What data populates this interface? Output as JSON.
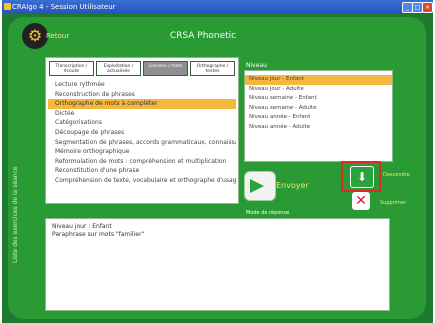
{
  "window": {
    "title": "CRAlgo 4 - Session Utilisateur",
    "buttons": {
      "minimize": "_",
      "maximize": "□",
      "close": "×"
    }
  },
  "header": {
    "title": "CRSA Phonetic",
    "home_label": "Retour"
  },
  "left_strip_label": "Liste des exercices de la séance",
  "tabs": [
    {
      "label": "Transcription / écoute",
      "active": false
    },
    {
      "label": "Exploitation / actualisée",
      "active": false
    },
    {
      "label": "Liaisons / mots",
      "active": true
    },
    {
      "label": "Orthographe / textes",
      "active": false
    }
  ],
  "exercises": [
    {
      "label": "Lecture rythmée",
      "selected": false
    },
    {
      "label": "Reconstruction de phrases",
      "selected": false
    },
    {
      "label": "Orthographe de mots à compléter",
      "selected": true
    },
    {
      "label": "Dictée",
      "selected": false
    },
    {
      "label": "Catégorisations",
      "selected": false
    },
    {
      "label": "Découpage de phrases",
      "selected": false
    },
    {
      "label": "Segmentation de phrases, accords grammaticaux, connaissances",
      "selected": false
    },
    {
      "label": "Mémoire orthographique",
      "selected": false
    },
    {
      "label": "Reformulation de mots : compréhension et multiplication",
      "selected": false
    },
    {
      "label": "Reconstitution d'une phrase",
      "selected": false
    },
    {
      "label": "Compréhension de texte, vocabulaire et orthographe d'usage",
      "selected": false
    }
  ],
  "niveaux": {
    "title": "Niveau",
    "items": [
      {
        "label": "Niveau jour - Enfant",
        "selected": true
      },
      {
        "label": "Niveau jour - Adulte",
        "selected": false
      },
      {
        "label": "Niveau semaine - Enfant",
        "selected": false
      },
      {
        "label": "Niveau semaine - Adulte",
        "selected": false
      },
      {
        "label": "Niveau année - Enfant",
        "selected": false
      },
      {
        "label": "Niveau année - Adulte",
        "selected": false
      }
    ]
  },
  "actions": {
    "send_label": "Envoyer",
    "down_label": "Descendre",
    "delete_label": "Supprimer",
    "answer_label": "Mode de réponse"
  },
  "bottom": {
    "lines": [
      "Niveau jour : Enfant",
      "Paraphrase sur mots \"familier\""
    ]
  }
}
